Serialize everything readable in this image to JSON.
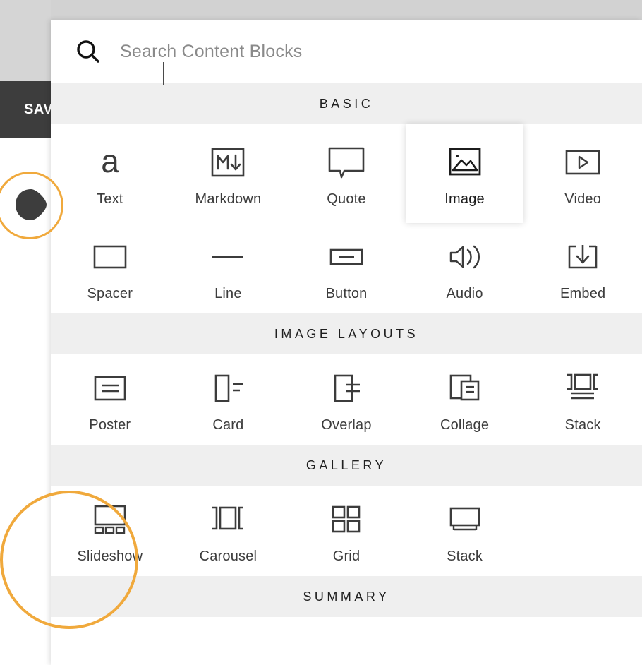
{
  "background": {
    "save_button_label": "SAVE",
    "save_button_bg": "#3d3d3d",
    "page_bg": "#d5d5d5"
  },
  "annotations": {
    "accent_color": "#f0a93c",
    "cursor_icon": "pointer-teardrop-icon",
    "highlight_target": "Slideshow"
  },
  "search": {
    "placeholder": "Search Content Blocks",
    "value": "",
    "icon": "search-icon"
  },
  "sections": [
    {
      "title": "BASIC",
      "rows": [
        [
          {
            "label": "Text",
            "icon": "text-a-icon",
            "selected": false
          },
          {
            "label": "Markdown",
            "icon": "markdown-icon",
            "selected": false
          },
          {
            "label": "Quote",
            "icon": "quote-bubble-icon",
            "selected": false
          },
          {
            "label": "Image",
            "icon": "image-mountain-icon",
            "selected": true
          },
          {
            "label": "Video",
            "icon": "video-play-icon",
            "selected": false
          }
        ],
        [
          {
            "label": "Spacer",
            "icon": "spacer-rect-icon",
            "selected": false
          },
          {
            "label": "Line",
            "icon": "horizontal-line-icon",
            "selected": false
          },
          {
            "label": "Button",
            "icon": "button-rect-icon",
            "selected": false
          },
          {
            "label": "Audio",
            "icon": "audio-speaker-icon",
            "selected": false
          },
          {
            "label": "Embed",
            "icon": "embed-download-icon",
            "selected": false
          }
        ]
      ]
    },
    {
      "title": "IMAGE LAYOUTS",
      "rows": [
        [
          {
            "label": "Poster",
            "icon": "poster-icon",
            "selected": false
          },
          {
            "label": "Card",
            "icon": "card-icon",
            "selected": false
          },
          {
            "label": "Overlap",
            "icon": "overlap-icon",
            "selected": false
          },
          {
            "label": "Collage",
            "icon": "collage-icon",
            "selected": false
          },
          {
            "label": "Stack",
            "icon": "stack-brackets-icon",
            "selected": false
          }
        ]
      ]
    },
    {
      "title": "GALLERY",
      "rows": [
        [
          {
            "label": "Slideshow",
            "icon": "slideshow-icon",
            "selected": false
          },
          {
            "label": "Carousel",
            "icon": "carousel-icon",
            "selected": false
          },
          {
            "label": "Grid",
            "icon": "grid-icon",
            "selected": false
          },
          {
            "label": "Stack",
            "icon": "gallery-stack-icon",
            "selected": false
          }
        ]
      ]
    },
    {
      "title": "SUMMARY",
      "rows": []
    }
  ]
}
